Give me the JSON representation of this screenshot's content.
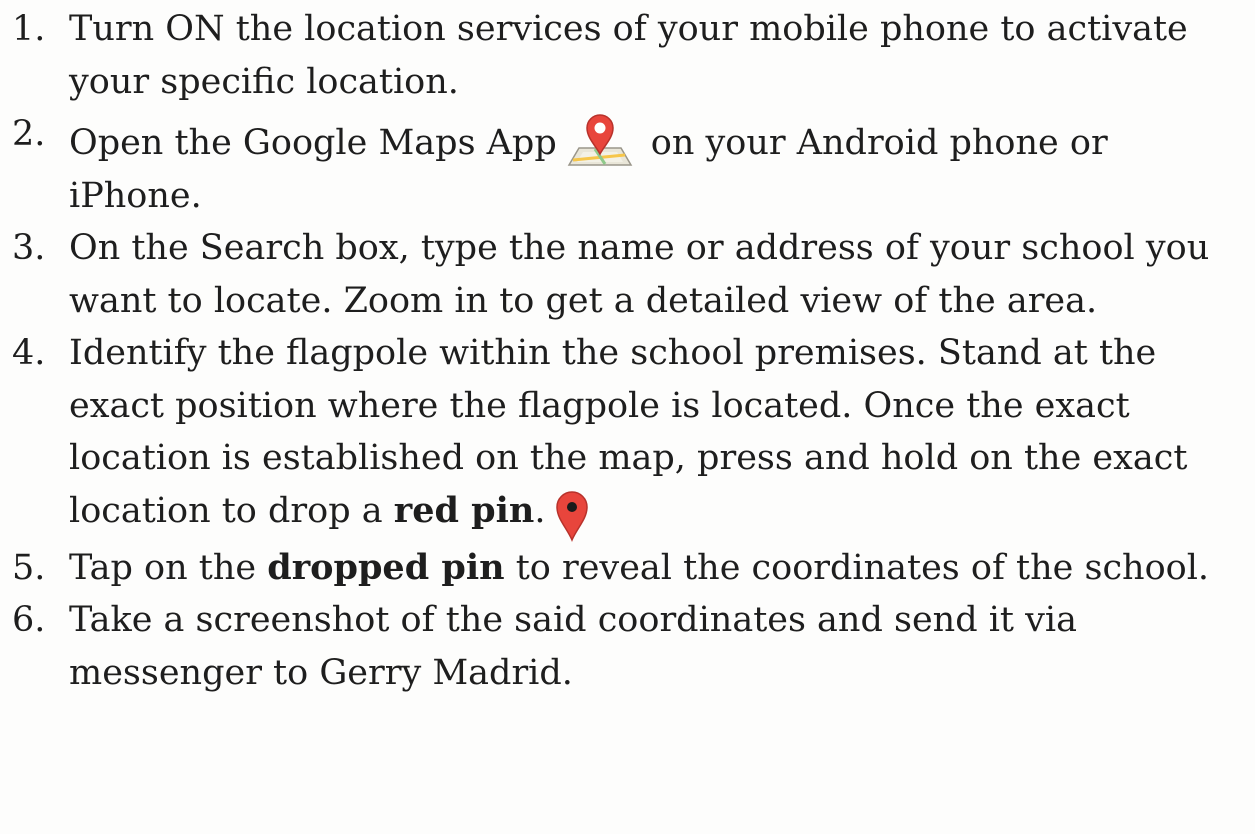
{
  "steps": [
    {
      "number": "1.",
      "text": "Turn ON the location services of your mobile phone to activate your specific location."
    },
    {
      "number": "2.",
      "before": "Open the Google Maps App",
      "icon": "google-maps-icon",
      "after": "on your Android phone or iPhone."
    },
    {
      "number": "3.",
      "text": "On the Search box, type the name or address of your school you want to locate. Zoom in to get a detailed view of the area."
    },
    {
      "number": "4.",
      "before": "Identify the flagpole within the school premises. Stand at the exact position where the flagpole is located. Once the exact location is established on the map, press and hold on the exact location to drop a",
      "bold": "red pin",
      "after": ".",
      "icon": "red-pin-icon"
    },
    {
      "number": "5.",
      "before": "Tap on the",
      "bold": "dropped pin",
      "after": "to reveal the coordinates of the school."
    },
    {
      "number": "6.",
      "text": "Take a screenshot of the said coordinates and send it via messenger to Gerry Madrid."
    }
  ],
  "colors": {
    "text": "#1e1e1e",
    "pin_red": "#e8453c",
    "pin_dark": "#b8322b",
    "map_paper": "#e9e6d8"
  }
}
